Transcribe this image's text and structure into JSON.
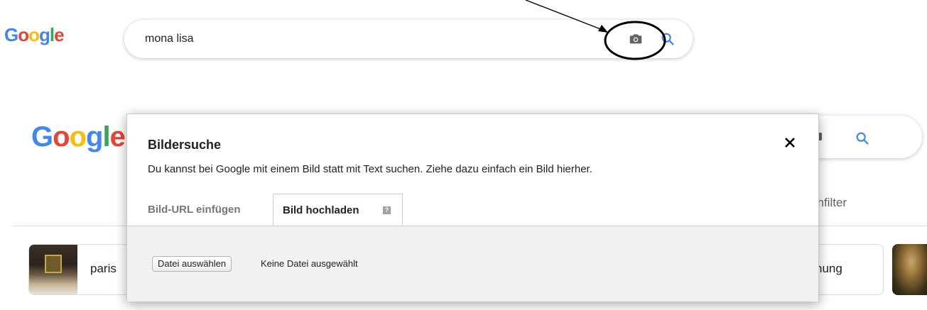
{
  "top_search": {
    "logo": "Google",
    "query": "mona lisa",
    "camera_icon": "camera-icon",
    "search_icon": "search-icon"
  },
  "background": {
    "logo": "Google",
    "filter_fragment": "chfilter",
    "chips": [
      {
        "label": "paris"
      },
      {
        "label": "schung"
      }
    ]
  },
  "dialog": {
    "title": "Bildersuche",
    "description": "Du kannst bei Google mit einem Bild statt mit Text suchen. Ziehe dazu einfach ein Bild hierher.",
    "close_icon": "close-icon",
    "tabs": [
      {
        "label": "Bild-URL einfügen",
        "active": false
      },
      {
        "label": "Bild hochladen",
        "active": true
      }
    ],
    "help_icon": "help-icon",
    "file_button": "Datei auswählen",
    "file_status": "Keine Datei ausgewählt"
  },
  "colors": {
    "google_blue": "#4285f4",
    "google_red": "#ea4335",
    "google_yellow": "#fbbc05",
    "google_green": "#34a853",
    "panel_bg": "#f1f1f1"
  }
}
